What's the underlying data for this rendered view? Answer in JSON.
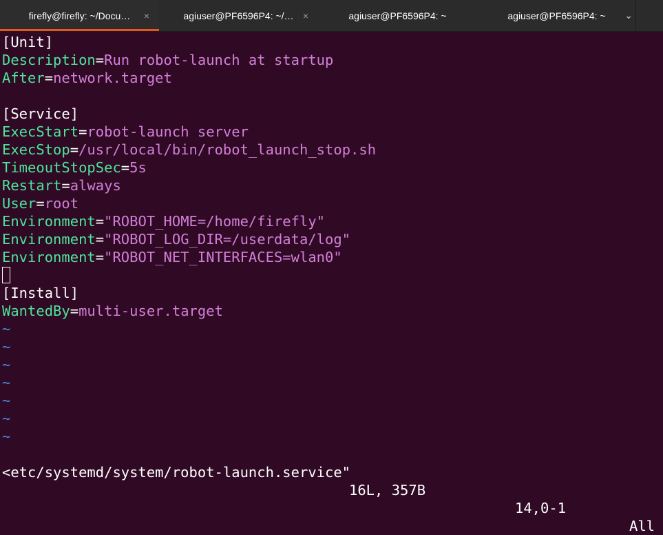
{
  "tabs": [
    {
      "label": "firefly@firefly: ~/Docu…",
      "active": true,
      "close": "×"
    },
    {
      "label": "agiuser@PF6596P4: ~/…",
      "active": false,
      "close": "×"
    },
    {
      "label": "agiuser@PF6596P4: ~",
      "active": false,
      "close": ""
    },
    {
      "label": "agiuser@PF6596P4: ~",
      "active": false,
      "close": ""
    }
  ],
  "tab_menu": "⌄",
  "file": {
    "line1": "[Unit]",
    "line2_key": "Description",
    "line2_val": "Run robot-launch at startup",
    "line3_key": "After",
    "line3_val": "network.target",
    "line5": "[Service]",
    "line6_key": "ExecStart",
    "line6_val": "robot-launch server",
    "line7_key": "ExecStop",
    "line7_val": "/usr/local/bin/robot_launch_stop.sh",
    "line8_key": "TimeoutStopSec",
    "line8_val": "5s",
    "line9_key": "Restart",
    "line9_val": "always",
    "line10_key": "User",
    "line10_val": "root",
    "line11_key": "Environment",
    "line11_val": "\"ROBOT_HOME=/home/firefly\"",
    "line12_key": "Environment",
    "line12_val": "\"ROBOT_LOG_DIR=/userdata/log\"",
    "line13_key": "Environment",
    "line13_val": "\"ROBOT_NET_INTERFACES=wlan0\"",
    "line15": "[Install]",
    "line16_key": "WantedBy",
    "line16_val": "multi-user.target",
    "eq": "=",
    "tilde": "~"
  },
  "status": {
    "file": "<etc/systemd/system/robot-launch.service\"",
    "counts": "16L, 357B",
    "position": "14,0-1",
    "scroll": "All"
  },
  "colors": {
    "background": "#300a24",
    "key": "#4ee39c",
    "value": "#d27fd8",
    "tilde": "#4b8bdf",
    "tab_accent": "#e95420"
  }
}
